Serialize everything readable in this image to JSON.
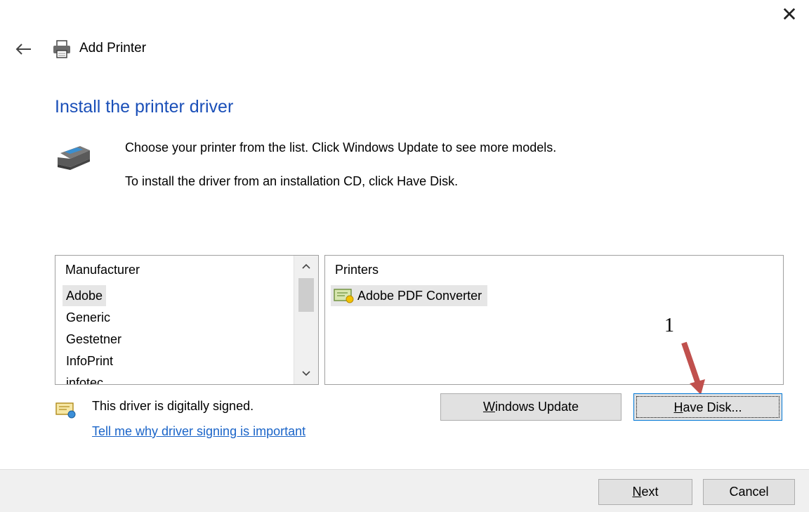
{
  "window": {
    "close_label": "✕",
    "title": "Add Printer"
  },
  "heading": "Install the printer driver",
  "instructions": {
    "line1": "Choose your printer from the list. Click Windows Update to see more models.",
    "line2": "To install the driver from an installation CD, click Have Disk."
  },
  "manufacturers": {
    "header": "Manufacturer",
    "items": [
      "Adobe",
      "Generic",
      "Gestetner",
      "InfoPrint",
      "infotec"
    ],
    "selected": "Adobe"
  },
  "printers": {
    "header": "Printers",
    "items": [
      "Adobe PDF Converter"
    ]
  },
  "buttons": {
    "windows_update_first": "W",
    "windows_update_rest": "indows Update",
    "have_disk_first": "H",
    "have_disk_rest": "ave Disk...",
    "next_first": "N",
    "next_rest": "ext",
    "cancel": "Cancel"
  },
  "signing": {
    "status": "This driver is digitally signed.",
    "link": "Tell me why driver signing is important"
  },
  "annotation": {
    "number": "1",
    "arrow_color": "#c0504d"
  },
  "colors": {
    "heading": "#1a4fb8",
    "link": "#1a64c8",
    "focus_border": "#0078d7"
  },
  "icons": {
    "back": "back-arrow-icon",
    "printer": "printer-icon",
    "signed": "certificate-icon"
  }
}
